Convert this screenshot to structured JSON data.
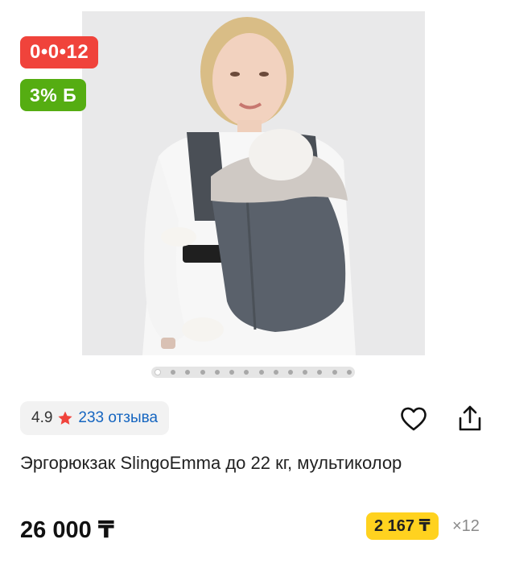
{
  "badges": {
    "timer": "0•0•12",
    "cashback": "3% Б"
  },
  "gallery": {
    "image_count": 14,
    "active_index": 0
  },
  "rating": {
    "score": "4.9",
    "reviews": "233 отзыва"
  },
  "product": {
    "title": "Эргорюкзак SlingoEmma до 22 кг, мультиколор",
    "price": "26 000 ₸",
    "installment": "2 167 ₸",
    "installment_months": "×12"
  },
  "colors": {
    "timer_badge": "#f0433b",
    "cashback_badge": "#55ad12",
    "installment_badge": "#ffd21f",
    "star": "#f0433b",
    "reviews_link": "#1565c0"
  },
  "icons": [
    "heart-icon",
    "share-icon",
    "star-icon"
  ]
}
